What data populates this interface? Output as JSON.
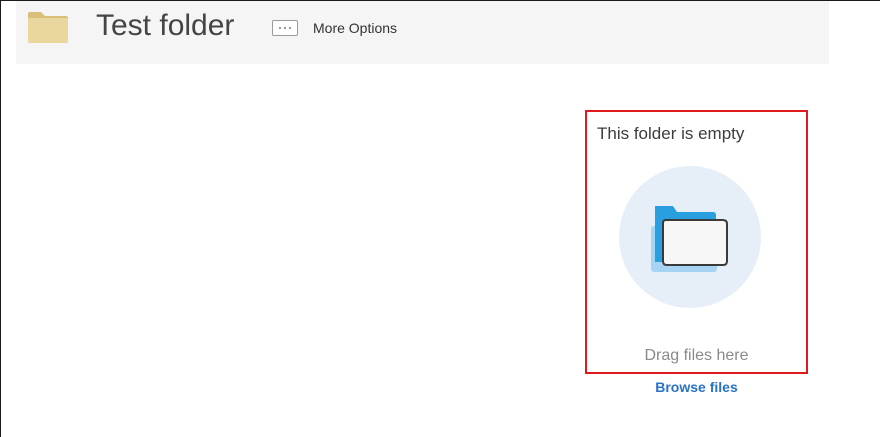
{
  "header": {
    "folder_icon": "folder-icon",
    "title": "Test folder",
    "more_options_icon": "ellipsis-icon",
    "more_options_label": "More Options"
  },
  "empty_state": {
    "title": "This folder is empty",
    "illustration_icon": "empty-folder-icon",
    "drag_text": "Drag files here",
    "browse_label": "Browse files"
  },
  "colors": {
    "header_bg": "#f5f5f5",
    "highlight_border": "#e0191e",
    "link": "#2a73c4",
    "illustration_bg": "#e6eef8",
    "folder_blue": "#2a9fe0",
    "folder_light_blue": "#9fd0f2",
    "header_folder": "#e8d39a"
  }
}
